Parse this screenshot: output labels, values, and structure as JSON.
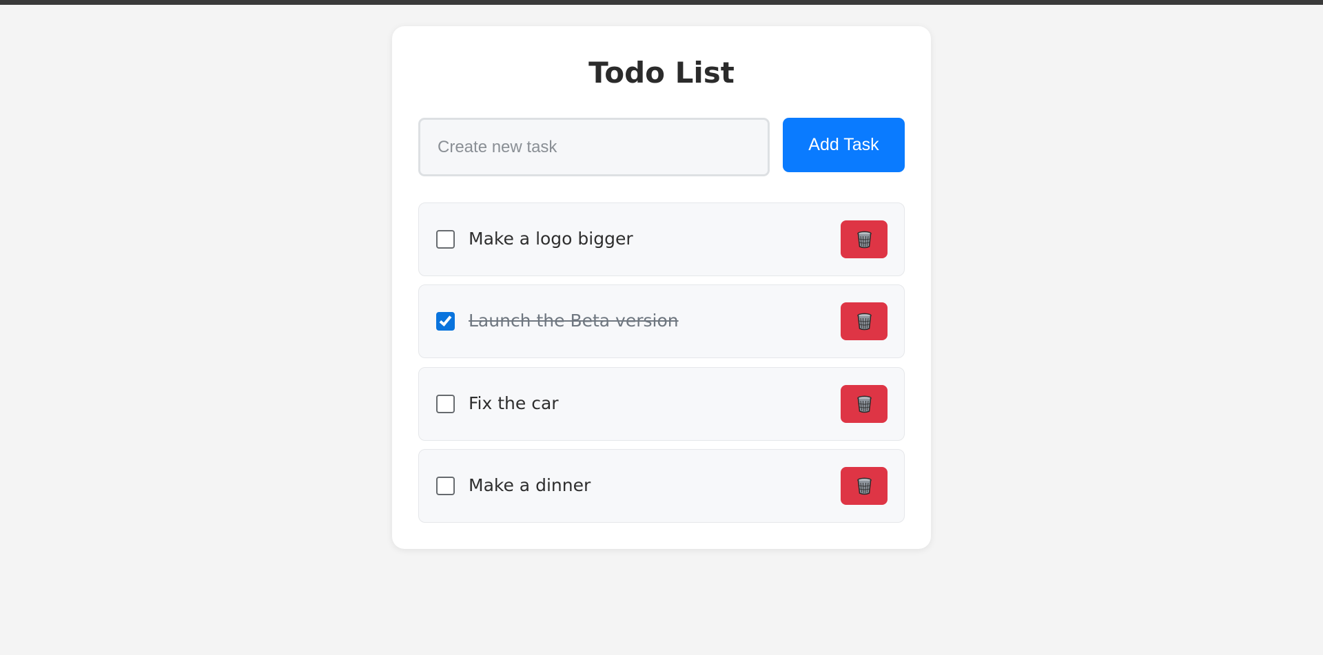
{
  "title": "Todo List",
  "new_task": {
    "placeholder": "Create new task",
    "value": ""
  },
  "add_button": "Add Task",
  "tasks": [
    {
      "text": "Make a logo bigger",
      "completed": false
    },
    {
      "text": "Launch the Beta version",
      "completed": true
    },
    {
      "text": "Fix the car",
      "completed": false
    },
    {
      "text": "Make a dinner",
      "completed": false
    }
  ],
  "icons": {
    "delete": "trash-icon",
    "check": "checkmark-icon"
  },
  "colors": {
    "primary": "#0a7bff",
    "danger": "#de3545",
    "checkbox_checked": "#0a74dd",
    "background": "#f4f4f4",
    "card": "#ffffff"
  }
}
